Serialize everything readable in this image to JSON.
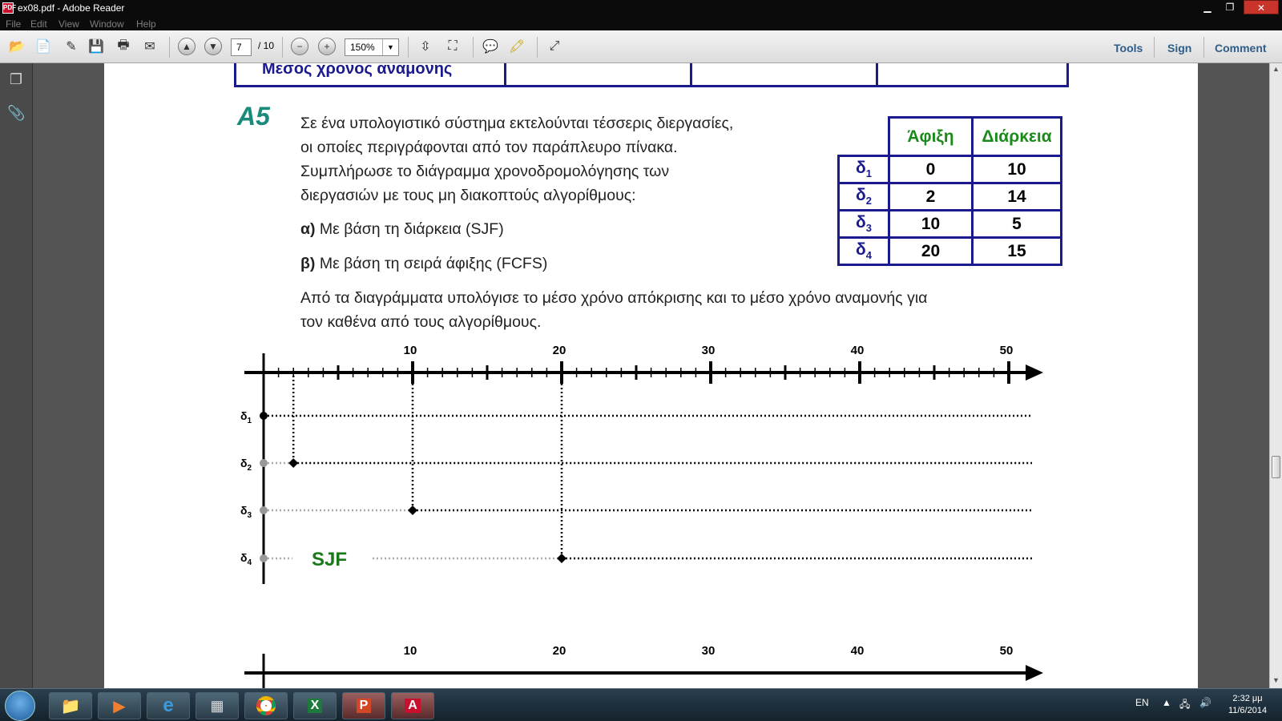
{
  "window": {
    "title": "ex08.pdf - Adobe Reader",
    "app_icon_label": "PDF"
  },
  "menu": [
    "File",
    "Edit",
    "View",
    "Window",
    "Help"
  ],
  "toolbar": {
    "page_current": "7",
    "page_total": "/ 10",
    "zoom": "150%",
    "tools_label": "Tools",
    "sign_label": "Sign",
    "comment_label": "Comment"
  },
  "page": {
    "prev_row_label": "Μεσος χρονος αναμονης",
    "exercise_label": "Α5",
    "intro_lines": [
      "Σε ένα υπολογιστικό σύστημα εκτελούνται τέσσερις διεργασίες,",
      "οι οποίες περιγράφονται από τον παράπλευρο πίνακα.",
      "Συμπλήρωσε το διάγραμμα χρονοδρομολόγησης των",
      "διεργασιών με τους μη διακοπτούς αλγορίθμους:"
    ],
    "item_a_prefix": "α)",
    "item_a_text": " Με βάση τη διάρκεια (SJF)",
    "item_b_prefix": "β)",
    "item_b_text": " Με βάση τη σειρά άφιξης (FCFS)",
    "final_lines": [
      "Από τα διαγράμματα υπολόγισε το μέσο χρόνο απόκρισης και το μέσο χρόνο αναμονής για",
      "τον καθένα από τους αλγορίθμους."
    ],
    "table": {
      "headers": [
        "Άφιξη",
        "Διάρκεια"
      ],
      "rows": [
        {
          "label": "δ",
          "sub": "1",
          "arrival": "0",
          "duration": "10"
        },
        {
          "label": "δ",
          "sub": "2",
          "arrival": "2",
          "duration": "14"
        },
        {
          "label": "δ",
          "sub": "3",
          "arrival": "10",
          "duration": "5"
        },
        {
          "label": "δ",
          "sub": "4",
          "arrival": "20",
          "duration": "15"
        }
      ]
    },
    "gantt": {
      "axis_ticks": [
        "10",
        "20",
        "30",
        "40",
        "50"
      ],
      "process_labels": [
        {
          "label": "δ",
          "sub": "1"
        },
        {
          "label": "δ",
          "sub": "2"
        },
        {
          "label": "δ",
          "sub": "3"
        },
        {
          "label": "δ",
          "sub": "4"
        }
      ],
      "arrivals": [
        0,
        2,
        10,
        20
      ],
      "algorithm_label": "SJF",
      "label_color": "#1a7a1a",
      "second_axis_ticks": [
        "10",
        "20",
        "30",
        "40",
        "50"
      ]
    }
  },
  "taskbar": {
    "language": "EN",
    "time": "2:32 μμ",
    "date": "11/6/2014"
  },
  "colors": {
    "table_border": "#1a1a8c",
    "header_green": "#1a8a1a",
    "exercise_teal": "#1a8a7a"
  }
}
